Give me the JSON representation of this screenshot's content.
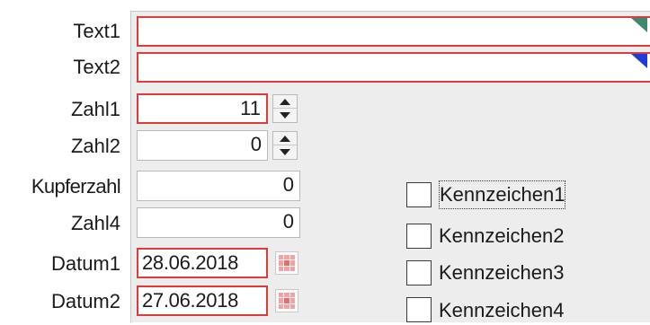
{
  "form": {
    "labels": {
      "text1": "Text1",
      "text2": "Text2",
      "zahl1": "Zahl1",
      "zahl2": "Zahl2",
      "kupferzahl": "Kupferzahl",
      "zahl4": "Zahl4",
      "datum1": "Datum1",
      "datum2": "Datum2"
    },
    "values": {
      "text1": "",
      "text2": "",
      "zahl1": "11",
      "zahl2": "0",
      "kupferzahl": "0",
      "zahl4": "0",
      "datum1": "28.06.2018",
      "datum2": "27.06.2018"
    },
    "checkboxes": [
      {
        "label": "Kennzeichen1",
        "checked": false,
        "focused": true
      },
      {
        "label": "Kennzeichen2",
        "checked": false,
        "focused": false
      },
      {
        "label": "Kennzeichen3",
        "checked": false,
        "focused": false
      },
      {
        "label": "Kennzeichen4",
        "checked": false,
        "focused": false
      }
    ]
  },
  "colors": {
    "invalid_border": "#e03a3a",
    "indicator_blue": "#1f3bd8",
    "indicator_green": "#3c8a6e",
    "panel_bg": "#ededed"
  },
  "icons": {
    "spin_up": "triangle-up-icon",
    "spin_down": "triangle-down-icon",
    "calendar": "calendar-icon"
  }
}
